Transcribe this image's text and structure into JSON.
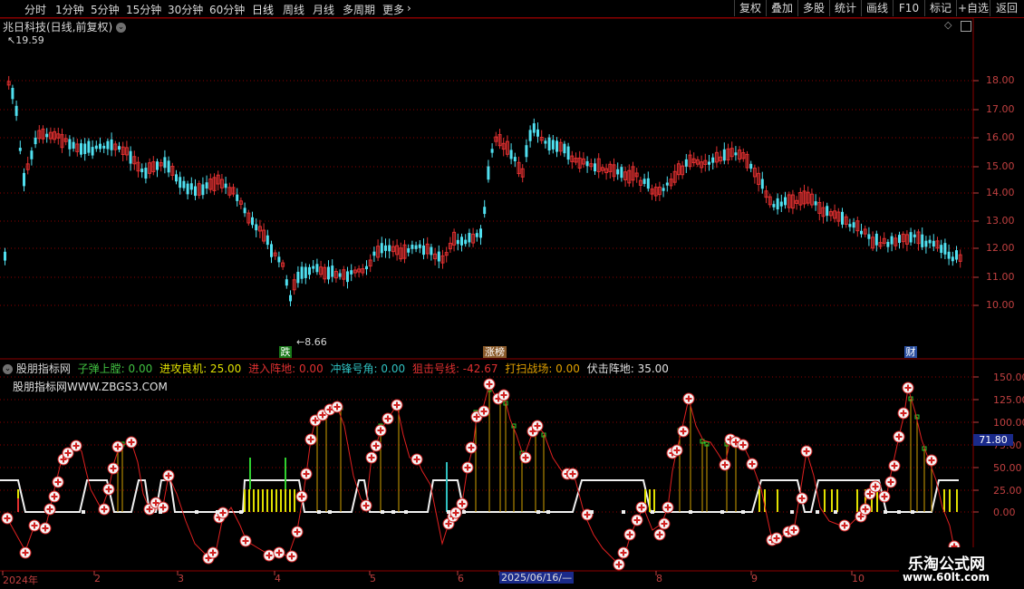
{
  "toolbar": {
    "periods": [
      "分时",
      "1分钟",
      "5分钟",
      "15分钟",
      "30分钟",
      "60分钟",
      "日线",
      "周线",
      "月线",
      "多周期",
      "更多"
    ],
    "active_period": "日线",
    "right_buttons": [
      "复权",
      "叠加",
      "多股",
      "统计",
      "画线",
      "F10",
      "标记",
      "+自选",
      "返回"
    ]
  },
  "main_chart": {
    "title": "兆日科技(日线,前复权)",
    "high_label": "19.59",
    "low_label": "8.66",
    "y_ticks": [
      "18.00",
      "17.00",
      "16.00",
      "15.00",
      "14.00",
      "13.00",
      "12.00",
      "11.00",
      "10.00"
    ],
    "markers": [
      {
        "text": "跌",
        "color": "#2ea02e"
      },
      {
        "text": "涨榜",
        "color": "#c04040"
      },
      {
        "text": "财",
        "color": "#3a6fd0"
      }
    ]
  },
  "indicator": {
    "name": "股朋指标网",
    "series_values": [
      {
        "label": "子弹上膛: 0.00",
        "color": "#40c040"
      },
      {
        "label": "进攻良机: 25.00",
        "color": "#e0e000"
      },
      {
        "label": "进入阵地: 0.00",
        "color": "#e03030"
      },
      {
        "label": "冲锋号角: 0.00",
        "color": "#30c0c0"
      },
      {
        "label": "狙击号线: -42.67",
        "color": "#e03030"
      },
      {
        "label": "打扫战场: 0.00",
        "color": "#e0a000"
      },
      {
        "label": "伏击阵地: 35.00",
        "color": "#e0e0e0"
      }
    ],
    "subtitle": "股朋指标网WWW.ZBGS3.COM",
    "y_ticks": [
      "150.00",
      "125.00",
      "100.00",
      "75.00",
      "50.00",
      "25.00",
      "0.00"
    ],
    "current_value": "71.80"
  },
  "time_axis": {
    "labels": [
      "2024年",
      "2",
      "3",
      "4",
      "5",
      "6",
      "2025/06/16/—",
      "8",
      "9",
      "10"
    ]
  },
  "watermark": {
    "line1": "乐淘公式网",
    "line2": "www.60lt.com"
  },
  "colors": {
    "up": "#e03030",
    "down": "#50e0f0",
    "grid": "#8b0000",
    "axis": "#c04040"
  }
}
